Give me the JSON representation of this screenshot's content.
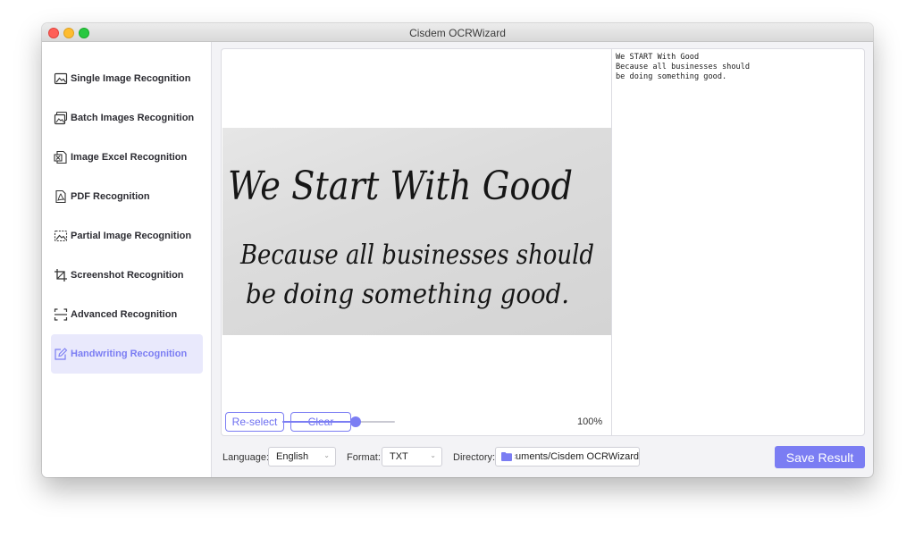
{
  "window": {
    "title": "Cisdem OCRWizard"
  },
  "sidebar": {
    "items": [
      {
        "label": "Single Image Recognition",
        "icon": "single-image-icon",
        "active": false
      },
      {
        "label": "Batch Images Recognition",
        "icon": "batch-images-icon",
        "active": false
      },
      {
        "label": "Image Excel Recognition",
        "icon": "excel-icon",
        "active": false
      },
      {
        "label": "PDF Recognition",
        "icon": "pdf-icon",
        "active": false
      },
      {
        "label": "Partial Image Recognition",
        "icon": "partial-image-icon",
        "active": false
      },
      {
        "label": "Screenshot Recognition",
        "icon": "screenshot-icon",
        "active": false
      },
      {
        "label": "Advanced Recognition",
        "icon": "advanced-scan-icon",
        "active": false
      },
      {
        "label": "Handwriting Recognition",
        "icon": "handwriting-icon",
        "active": true
      }
    ]
  },
  "image_preview": {
    "handwritten_lines": [
      "We Start With Good",
      "Because all businesses should",
      "be doing something good."
    ]
  },
  "result": {
    "lines": [
      "We START With Good",
      "Because all businesses should",
      "be doing something good."
    ]
  },
  "controls": {
    "reselect_label": "Re-select",
    "clear_label": "Clear",
    "zoom_fraction": 0.65,
    "zoom_text": "100%"
  },
  "bottom_bar": {
    "language_label": "Language:",
    "language_value": "English",
    "format_label": "Format:",
    "format_value": "TXT",
    "directory_label": "Directory:",
    "directory_value": "Documents/Cisdem OCRWizard",
    "save_label": "Save Result"
  },
  "colors": {
    "accent": "#7b7df3",
    "active_bg": "#e9e9fc"
  }
}
